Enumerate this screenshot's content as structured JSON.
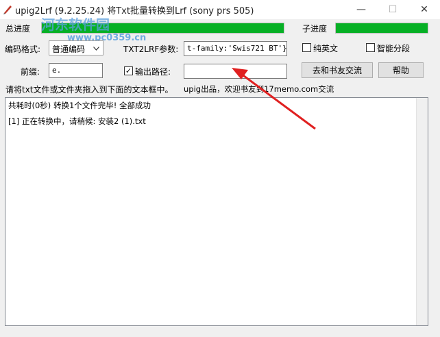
{
  "window": {
    "title": "upig2Lrf (9.2.25.24) 将Txt批量转换到Lrf (sony prs 505)",
    "controls": {
      "minimize": "—",
      "maximize": "☐",
      "close": "✕"
    }
  },
  "progress": {
    "main_label": "总进度",
    "main_value": 1.0,
    "sub_label": "子进度",
    "sub_value": 1.0,
    "color": "#06b025"
  },
  "form": {
    "encoding_label": "编码格式:",
    "encoding_value": "普通编码",
    "param_label": "TXT2LRF参数:",
    "param_value": "t-family:'Swis721 BT'}\"",
    "pure_english_label": "纯英文",
    "smart_para_label": "智能分段",
    "prefix_label": "前缀:",
    "prefix_value": "e.",
    "output_path_label": "输出路径:",
    "output_path_value": "",
    "forum_button": "去和书友交流",
    "help_button": "帮助",
    "instruction": "请将txt文件或文件夹拖入到下面的文本框中。",
    "credit": "upig出品，欢迎书友到17memo.com交流"
  },
  "log": [
    "共耗时(0秒) 转换1个文件完毕! 全部成功",
    "[1]  正在转换中，请稍候: 安装2 (1).txt"
  ],
  "watermark": {
    "text": "河东软件园",
    "url": "www.pc0359.cn"
  }
}
